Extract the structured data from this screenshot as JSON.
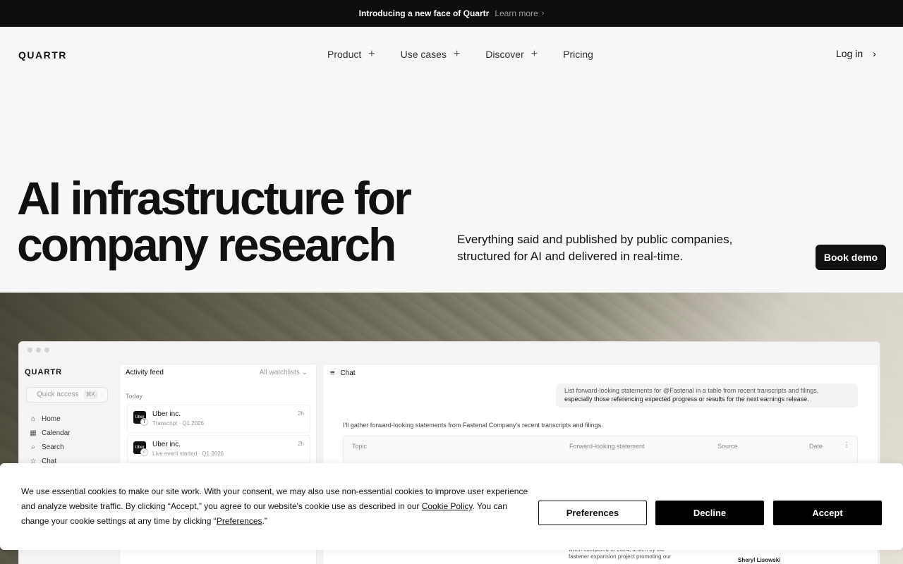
{
  "announcement": {
    "text": "Introducing a new face of Quartr",
    "link": "Learn more",
    "chevron": "›"
  },
  "nav": {
    "logo": "QUARTR",
    "items": [
      {
        "label": "Product",
        "expand": "+"
      },
      {
        "label": "Use cases",
        "expand": "+"
      },
      {
        "label": "Discover",
        "expand": "+"
      },
      {
        "label": "Pricing"
      }
    ],
    "login": "Log in",
    "login_chevron": "›"
  },
  "hero": {
    "title_line1": "AI infrastructure for",
    "title_line2": "company research",
    "subtitle_line1": "Everything said and published by public companies,",
    "subtitle_line2": "structured for AI and delivered in real-time.",
    "cta": "Book demo"
  },
  "app": {
    "logo": "QUARTR",
    "quick_access": "Quick access",
    "quick_access_shortcut": "⌘K",
    "sidebar": [
      {
        "icon": "⌂",
        "label": "Home"
      },
      {
        "icon": "▦",
        "label": "Calendar"
      },
      {
        "icon": "⌕",
        "label": "Search"
      },
      {
        "icon": "☆",
        "label": "Chat"
      }
    ],
    "feed": {
      "title": "Activity feed",
      "filter": "All watchlists ⌄",
      "group": "Today",
      "items": [
        {
          "avatar": "Uber",
          "badge": "T",
          "name": "Uber inc.",
          "type": "Transcript",
          "period": "Q1 2026",
          "ago": "2h"
        },
        {
          "avatar": "Uber",
          "badge": "○",
          "name": "Uber inc.",
          "type": "Live event started",
          "period": "Q1 2026",
          "ago": "2h"
        }
      ],
      "separator": "·"
    },
    "chat": {
      "title": "Chat",
      "hamburger": "≡",
      "prompt_line1": "List forward-looking statements for @Fastenal in a table from recent transcripts and filings,",
      "prompt_line2": "especially those referencing expected progress or results for the next earnings release.",
      "reply": "I'll gather forward-looking statements from Fastenal Company's recent transcripts and filings.",
      "table_headers": [
        "Topic",
        "Forward-looking  statement",
        "Source",
        "Date"
      ],
      "table_more": "⋮",
      "partial_line1": "when compared to 2024, driven by the",
      "partial_line2": "fastener expansion project promoting our",
      "partial_person": "Sheryl Lisowski"
    }
  },
  "cookie": {
    "text_before_policy": "We use essential cookies to make our site work. With your consent, we may also use non-essential cookies to improve user experience and analyze website traffic. By clicking “Accept,” you agree to our website's cookie use as described in our ",
    "policy_link": "Cookie Policy",
    "text_after_policy": ". You can change your cookie settings at any time by clicking “",
    "preferences_link": "Preferences",
    "text_end": ".”",
    "buttons": {
      "preferences": "Preferences",
      "decline": "Decline",
      "accept": "Accept"
    }
  }
}
